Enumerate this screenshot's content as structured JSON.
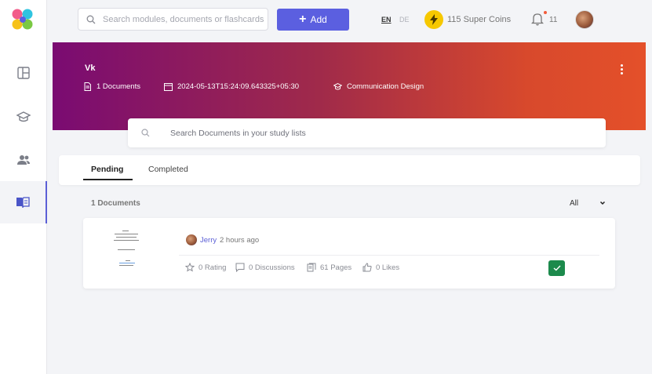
{
  "header": {
    "search_placeholder": "Search modules, documents or flashcards",
    "add_label": "Add",
    "lang_en": "EN",
    "lang_de": "DE",
    "coins_label": "115 Super Coins",
    "notification_count": "11"
  },
  "sidebar": {
    "items": [
      {
        "name": "dashboard",
        "icon": "layout-icon"
      },
      {
        "name": "courses",
        "icon": "graduation-cap-icon"
      },
      {
        "name": "community",
        "icon": "users-icon"
      },
      {
        "name": "study-lists",
        "icon": "book-icon",
        "active": true
      }
    ]
  },
  "banner": {
    "title": "Vk",
    "documents": "1 Documents",
    "date": "2024-05-13T15:24:09.643325+05:30",
    "category": "Communication Design"
  },
  "doc_search": {
    "placeholder": "Search Documents in your study lists"
  },
  "tabs": [
    "Pending",
    "Completed"
  ],
  "list": {
    "count_label": "1 Documents",
    "filter_value": "All"
  },
  "document": {
    "author": "Jerry",
    "time": "2 hours ago",
    "rating": "0 Rating",
    "discussions": "0 Discussions",
    "pages": "61 Pages",
    "likes": "0 Likes"
  },
  "colors": {
    "accent": "#5b5fe0",
    "banner_start": "#7a0b72",
    "banner_end": "#e4502a",
    "success": "#1c8a4c"
  }
}
